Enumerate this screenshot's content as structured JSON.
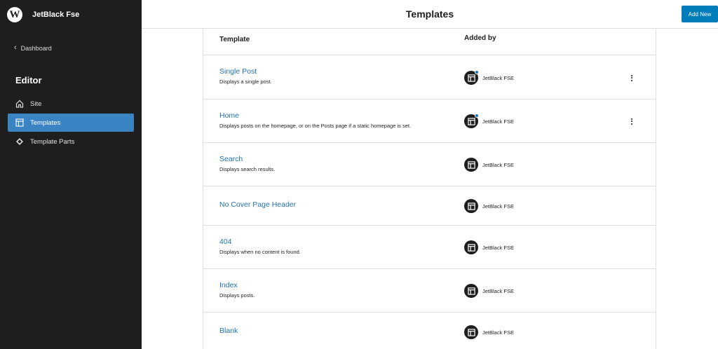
{
  "sidebar": {
    "site_title": "JetBlack Fse",
    "logo_glyph": "W",
    "back_label": "Dashboard",
    "section_title": "Editor",
    "items": [
      {
        "label": "Site",
        "icon": "home-icon"
      },
      {
        "label": "Templates",
        "icon": "layout-icon",
        "active": true
      },
      {
        "label": "Template Parts",
        "icon": "symbol-diamond-icon"
      }
    ]
  },
  "header": {
    "title": "Templates",
    "add_new_label": "Add New"
  },
  "table": {
    "columns": {
      "template": "Template",
      "added_by": "Added by"
    },
    "rows": [
      {
        "name": "Single Post",
        "description": "Displays a single post.",
        "author": "JetBlack FSE",
        "customized": true,
        "has_menu": true
      },
      {
        "name": "Home",
        "description": "Displays posts on the homepage, or on the Posts page if a static homepage is set.",
        "author": "JetBlack FSE",
        "customized": true,
        "has_menu": true
      },
      {
        "name": "Search",
        "description": "Displays search results.",
        "author": "JetBlack FSE",
        "customized": false,
        "has_menu": false
      },
      {
        "name": "No Cover Page Header",
        "description": "",
        "author": "JetBlack FSE",
        "customized": false,
        "has_menu": false
      },
      {
        "name": "404",
        "description": "Displays when no content is found.",
        "author": "JetBlack FSE",
        "customized": false,
        "has_menu": false
      },
      {
        "name": "Index",
        "description": "Displays posts.",
        "author": "JetBlack FSE",
        "customized": false,
        "has_menu": false
      },
      {
        "name": "Blank",
        "description": "",
        "author": "JetBlack FSE",
        "customized": false,
        "has_menu": false
      }
    ]
  },
  "colors": {
    "sidebar_bg": "#1e1e1e",
    "active_item": "#3b84c4",
    "link": "#2271b1",
    "primary_button": "#007cba"
  }
}
